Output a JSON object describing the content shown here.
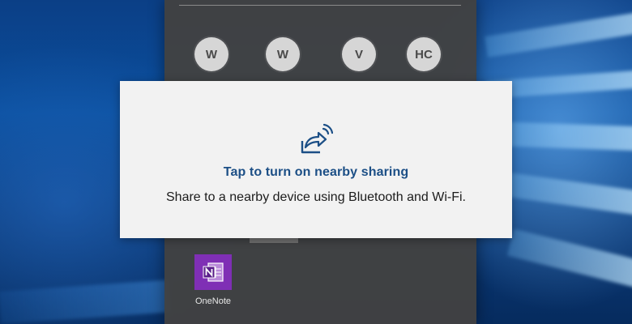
{
  "share_panel": {
    "contacts": [
      {
        "initials": "W"
      },
      {
        "initials": "W"
      },
      {
        "initials": "V"
      },
      {
        "initials": "HC"
      }
    ],
    "apps": [
      {
        "label": "OneNote",
        "icon": "onenote-icon",
        "color": "#7f2fb5"
      }
    ]
  },
  "notification": {
    "icon": "nearby-share-icon",
    "title": "Tap to turn on nearby sharing",
    "body": "Share to a nearby device using Bluetooth and Wi-Fi.",
    "title_color": "#1c4f86"
  }
}
